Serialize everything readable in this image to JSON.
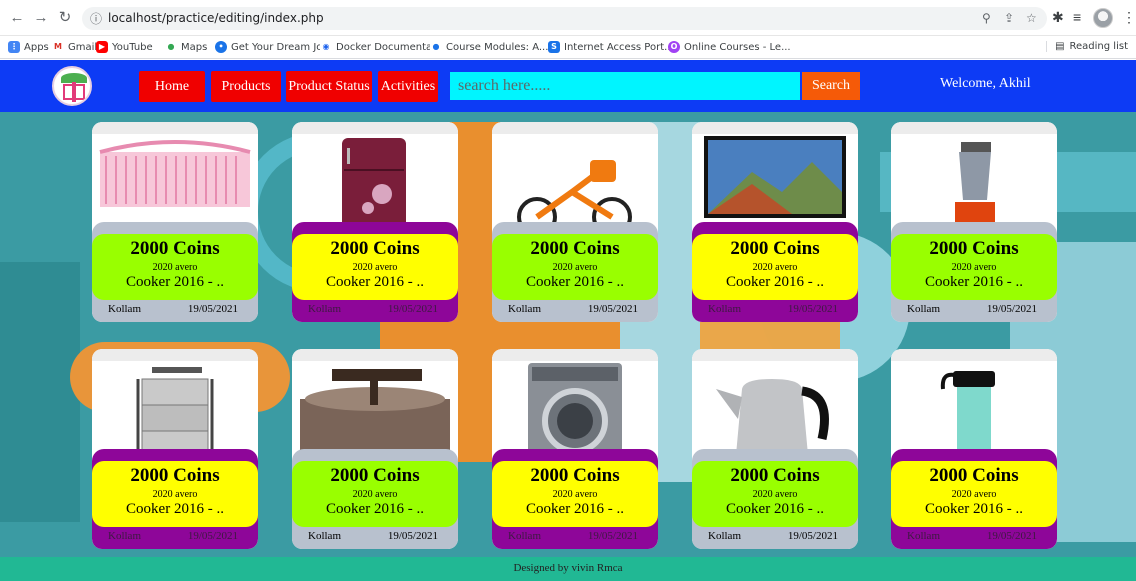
{
  "browser": {
    "url": "localhost/practice/editing/index.php",
    "bookmarks": [
      "Apps",
      "Gmail",
      "YouTube",
      "Maps",
      "Get Your Dream Jo...",
      "Docker Documenta...",
      "Course Modules: A...",
      "Internet Access Port...",
      "Online Courses - Le..."
    ],
    "reading_list": "Reading list"
  },
  "navbar": {
    "links": [
      "Home",
      "Products",
      "Product Status",
      "Activities"
    ],
    "search_placeholder": "search here.....",
    "search_button": "Search",
    "welcome": "Welcome, Akhil",
    "brand_color": "#0d3bf5",
    "link_color": "#f00000"
  },
  "products": [
    {
      "coins": "2000 Coins",
      "subtitle": "2020 avero",
      "title": "Cooker 2016 - ..",
      "location": "Kollam",
      "date": "19/05/2021",
      "style": "green",
      "image": "crib-icon"
    },
    {
      "coins": "2000 Coins",
      "subtitle": "2020 avero",
      "title": "Cooker 2016 - ..",
      "location": "Kollam",
      "date": "19/05/2021",
      "style": "yellow",
      "image": "refrigerator-icon"
    },
    {
      "coins": "2000 Coins",
      "subtitle": "2020 avero",
      "title": "Cooker 2016 - ..",
      "location": "Kollam",
      "date": "19/05/2021",
      "style": "green",
      "image": "bicycle-icon"
    },
    {
      "coins": "2000 Coins",
      "subtitle": "2020 avero",
      "title": "Cooker 2016 - ..",
      "location": "Kollam",
      "date": "19/05/2021",
      "style": "yellow",
      "image": "television-icon"
    },
    {
      "coins": "2000 Coins",
      "subtitle": "2020 avero",
      "title": "Cooker 2016 - ..",
      "location": "Kollam",
      "date": "19/05/2021",
      "style": "green",
      "image": "mixer-icon"
    },
    {
      "coins": "2000 Coins",
      "subtitle": "2020 avero",
      "title": "Cooker 2016 - ..",
      "location": "Kollam",
      "date": "19/05/2021",
      "style": "yellow",
      "image": "tiffin-box-icon"
    },
    {
      "coins": "2000 Coins",
      "subtitle": "2020 avero",
      "title": "Cooker 2016 - ..",
      "location": "Kollam",
      "date": "19/05/2021",
      "style": "green",
      "image": "grinder-icon"
    },
    {
      "coins": "2000 Coins",
      "subtitle": "2020 avero",
      "title": "Cooker 2016 - ..",
      "location": "Kollam",
      "date": "19/05/2021",
      "style": "yellow",
      "image": "washing-machine-icon"
    },
    {
      "coins": "2000 Coins",
      "subtitle": "2020 avero",
      "title": "Cooker 2016 - ..",
      "location": "Kollam",
      "date": "19/05/2021",
      "style": "green",
      "image": "kettle-icon"
    },
    {
      "coins": "2000 Coins",
      "subtitle": "2020 avero",
      "title": "Cooker 2016 - ..",
      "location": "Kollam",
      "date": "19/05/2021",
      "style": "yellow",
      "image": "water-bottle-icon"
    }
  ],
  "footer": {
    "text": "Designed by vivin Rmca"
  }
}
